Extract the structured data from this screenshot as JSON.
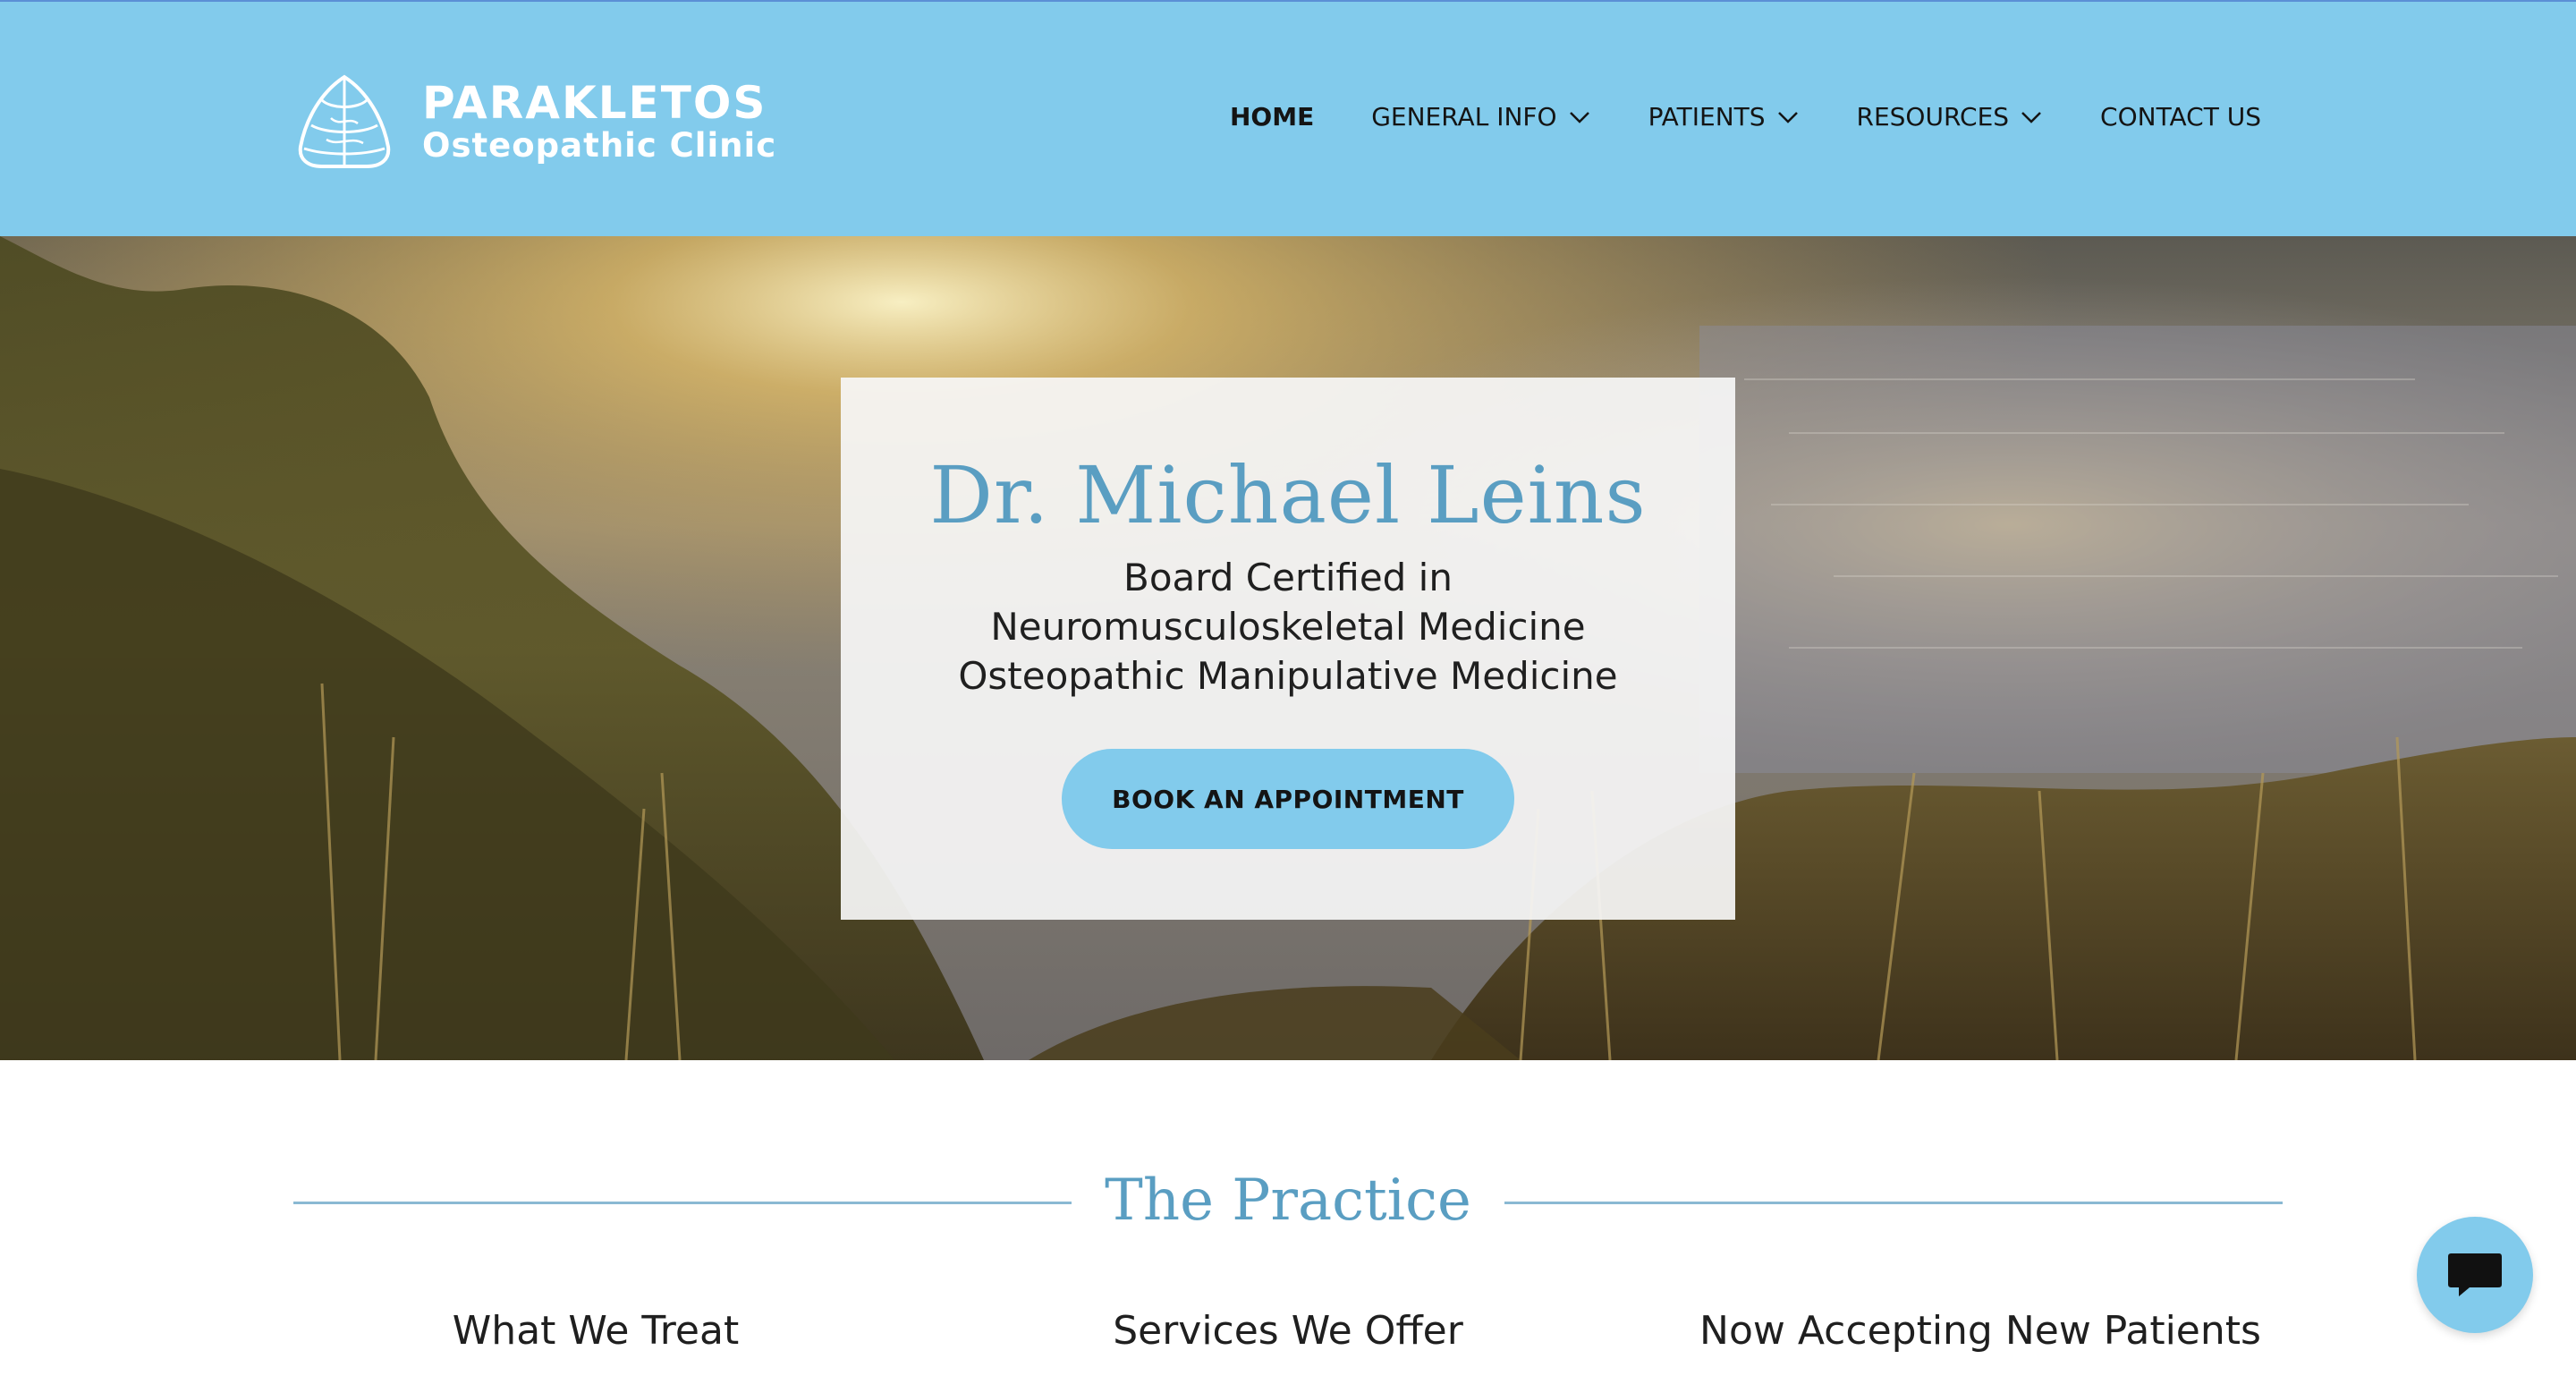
{
  "brand": {
    "name": "PARAKLETOS",
    "tagline": "Osteopathic Clinic"
  },
  "nav": {
    "items": [
      {
        "label": "HOME",
        "active": true,
        "dropdown": false
      },
      {
        "label": "GENERAL INFO",
        "active": false,
        "dropdown": true
      },
      {
        "label": "PATIENTS",
        "active": false,
        "dropdown": true
      },
      {
        "label": "RESOURCES",
        "active": false,
        "dropdown": true
      },
      {
        "label": "CONTACT US",
        "active": false,
        "dropdown": false
      }
    ]
  },
  "hero": {
    "name": "Dr. Michael Leins",
    "lines": [
      "Board Certified in",
      "Neuromusculoskeletal Medicine",
      "Osteopathic Manipulative Medicine"
    ],
    "button_label": "BOOK AN APPOINTMENT",
    "background": "sunset-lake-grass-photo"
  },
  "practice": {
    "title": "The Practice",
    "columns": [
      {
        "title": "What We Treat"
      },
      {
        "title": "Services We Offer"
      },
      {
        "title": "Now Accepting New Patients"
      }
    ]
  },
  "chat": {
    "icon": "chat-bubble-icon"
  },
  "colors": {
    "header": "#82cbec",
    "accent_text": "#5a9ec2",
    "button": "#82cbec"
  }
}
